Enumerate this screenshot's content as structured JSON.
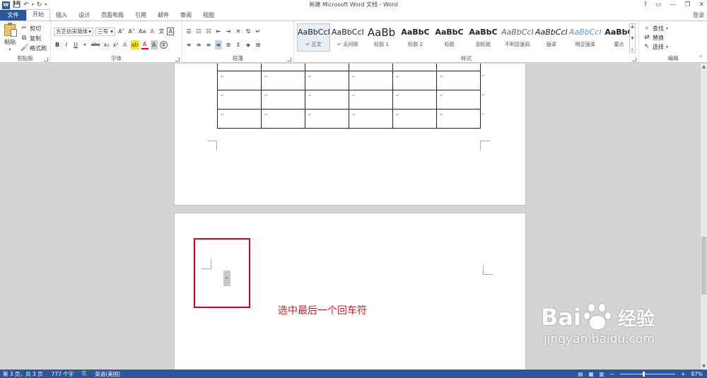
{
  "window": {
    "title": "新建 Microsoft Word 文档 - Word",
    "controls": [
      "?",
      "▭",
      "—",
      "❐",
      "✕"
    ],
    "sign_in": "登录"
  },
  "quick_access": {
    "logo": "W",
    "save_icon": "save-icon",
    "undo_icon": "undo-icon",
    "redo_icon": "redo-icon",
    "customize_icon": "customize-icon"
  },
  "tabs": [
    "文件",
    "开始",
    "插入",
    "设计",
    "页面布局",
    "引用",
    "邮件",
    "审阅",
    "视图"
  ],
  "active_tab": "开始",
  "ribbon": {
    "clipboard": {
      "label": "剪贴板",
      "paste": "粘贴",
      "cut": "剪切",
      "copy": "复制",
      "format_painter": "格式刷"
    },
    "font": {
      "label": "字体",
      "font_name": "方正仿宋简体",
      "font_size": "三号",
      "grow": "A˄",
      "shrink": "A˅",
      "case": "Aa",
      "clear": "A",
      "phonetic": "文",
      "border_char": "A",
      "bold": "B",
      "italic": "I",
      "underline": "U",
      "strike": "abc",
      "subscript": "x₂",
      "superscript": "x²",
      "effects": "A",
      "highlight": "ab",
      "font_color": "A",
      "shade": "A",
      "enclose": "字"
    },
    "paragraph": {
      "label": "段落"
    },
    "styles": {
      "label": "样式",
      "items": [
        {
          "preview": "AaBbCcI",
          "name": "↵ 正文"
        },
        {
          "preview": "AaBbCcI",
          "name": "↵ 无间隔"
        },
        {
          "preview": "AaBb",
          "name": "标题 1"
        },
        {
          "preview": "AaBbC",
          "name": "标题 2"
        },
        {
          "preview": "AaBbC",
          "name": "标题"
        },
        {
          "preview": "AaBbC",
          "name": "副标题"
        },
        {
          "preview": "AaBbCcI",
          "name": "不明显强调"
        },
        {
          "preview": "AaBbCcI",
          "name": "强调"
        },
        {
          "preview": "AaBbCcI",
          "name": "明显强调"
        },
        {
          "preview": "AaBbC",
          "name": "要点"
        }
      ]
    },
    "editing": {
      "label": "编辑",
      "find": "查找",
      "replace": "替换",
      "select": "选择"
    }
  },
  "document": {
    "table_rows": 4,
    "table_cols": 6,
    "mark": "↵",
    "annotation": "选中最后一个回车符"
  },
  "status": {
    "page": "第 3 页，共 3 页",
    "words": "777 个字",
    "language": "英语(美国)",
    "zoom": "97%"
  },
  "watermark": {
    "logo_text": "Bai",
    "logo_text2": "经验",
    "url": "jingyan.baidu.com"
  },
  "colors": {
    "word_blue": "#2b579a",
    "annotation_red": "#c0242b",
    "highlight_box": "#d0021b"
  }
}
